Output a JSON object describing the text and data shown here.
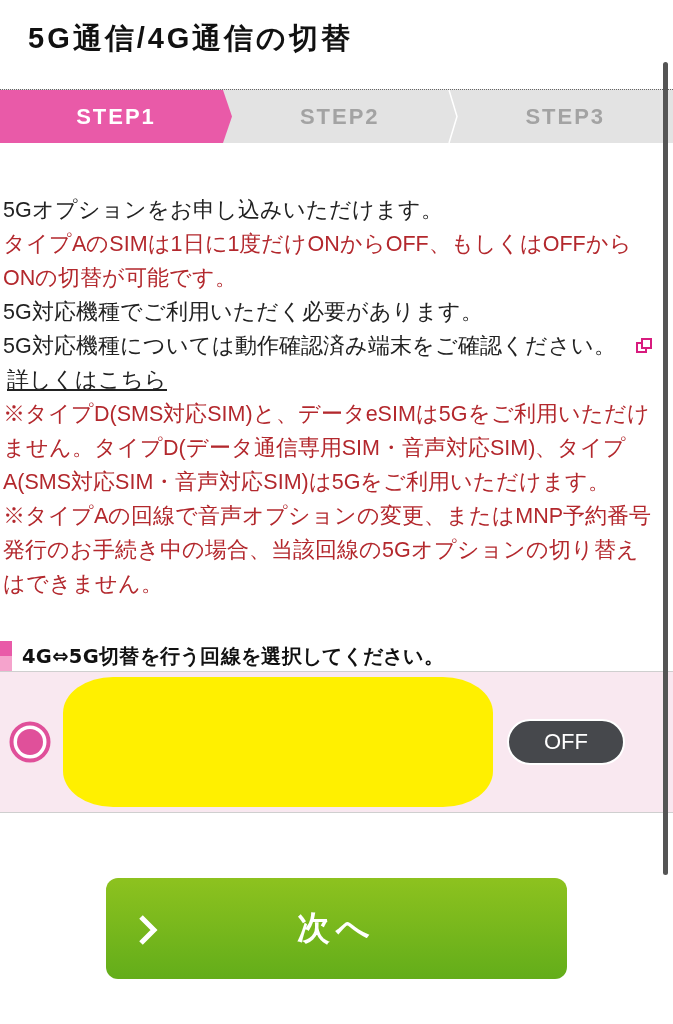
{
  "title": "5G通信/4G通信の切替",
  "steps": [
    {
      "label": "STEP1",
      "selected": true
    },
    {
      "label": "STEP2",
      "selected": false
    },
    {
      "label": "STEP3",
      "selected": false
    }
  ],
  "notes": [
    {
      "kind": "plain",
      "text": "5Gオプションをお申し込みいただけます。"
    },
    {
      "kind": "warning",
      "text": "タイプAのSIMは1日に1度だけONからOFF、もしくはOFFからONの切替が可能です。"
    },
    {
      "kind": "plain",
      "text": "5G対応機種でご利用いただく必要があります。"
    },
    {
      "kind": "plain",
      "text": "5G対応機種については動作確認済み端末をご確認ください。",
      "link": "詳しくはこちら"
    },
    {
      "kind": "warning",
      "text": "※タイプD(SMS対応SIM)と、データeSIMは5Gをご利用いただけません。タイプD(データ通信専用SIM・音声対応SIM)、タイプA(SMS対応SIM・音声対応SIM)は5Gをご利用いただけます。"
    },
    {
      "kind": "warning",
      "text": "※タイプAの回線で音声オプションの変更、またはMNP予約番号発行のお手続き中の場合、当該回線の5Gオプションの切り替えはできません。"
    }
  ],
  "section_heading": "4G⇔5G切替を行う回線を選択してください。",
  "lines": [
    {
      "selected": true,
      "toggle": {
        "label": "OFF",
        "on": false
      }
    }
  ],
  "next_button": {
    "label": "次へ"
  }
}
